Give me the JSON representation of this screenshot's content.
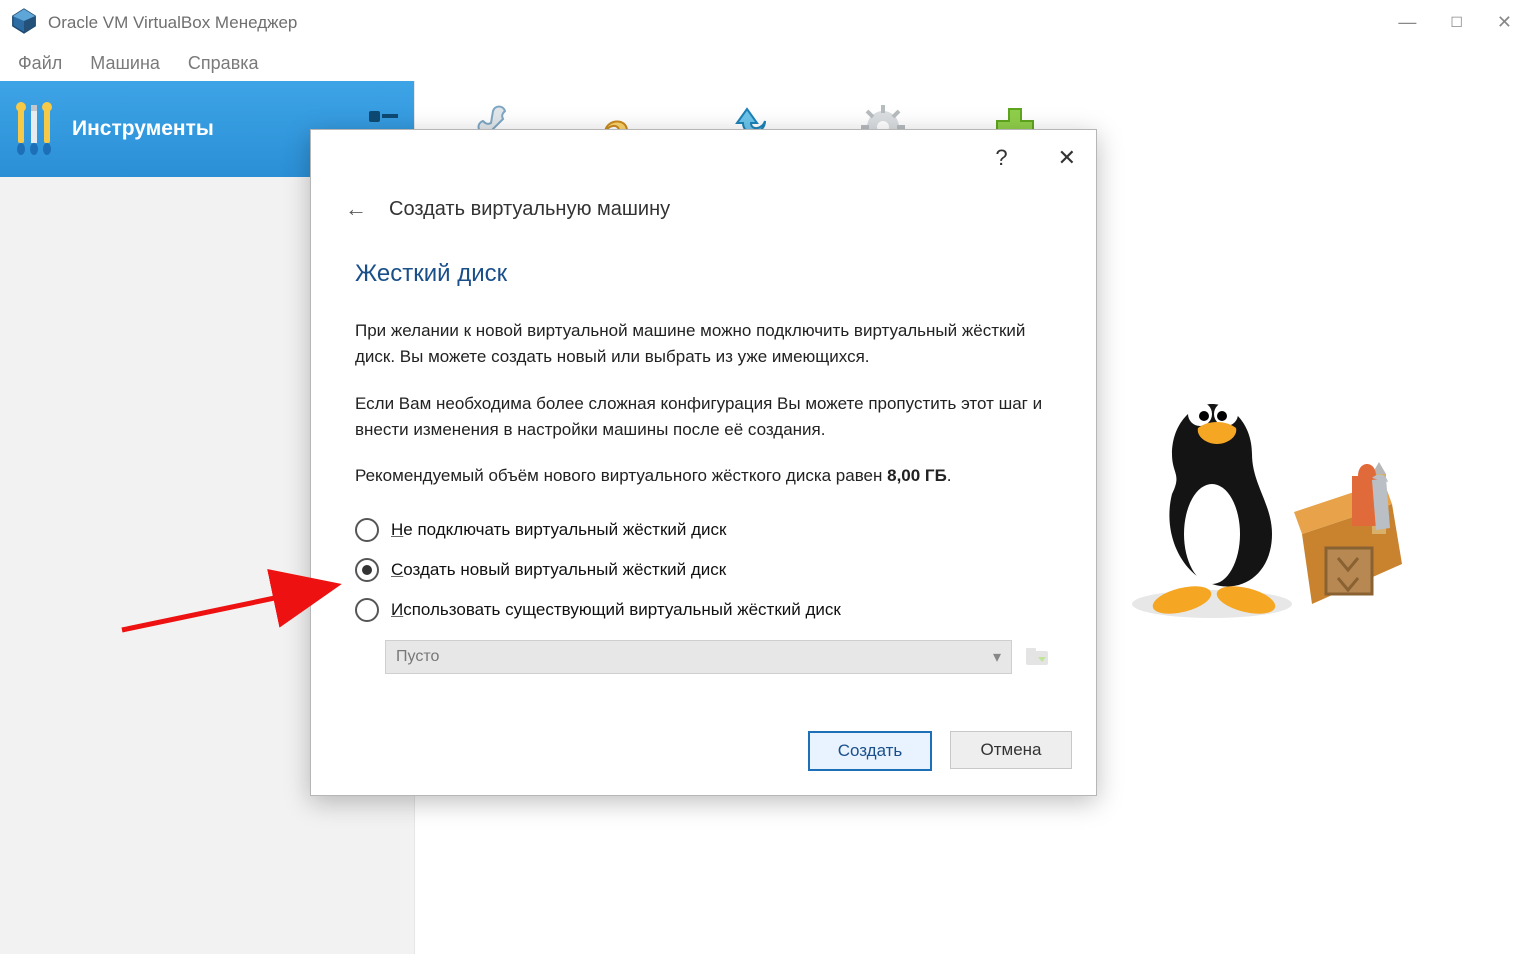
{
  "titlebar": {
    "title": "Oracle VM VirtualBox Менеджер"
  },
  "menubar": {
    "file": "Файл",
    "machine": "Машина",
    "help": "Справка"
  },
  "sidebar": {
    "tools": "Инструменты"
  },
  "dialog": {
    "help": "?",
    "title": "Создать виртуальную машину",
    "section": "Жесткий диск",
    "para1": "При желании к новой виртуальной машине можно подключить виртуальный жёсткий диск. Вы можете создать новый или выбрать из уже имеющихся.",
    "para2": "Если Вам необходима более сложная конфигурация Вы можете пропустить этот шаг и внести изменения в настройки машины после её создания.",
    "para3a": "Рекомендуемый объём нового виртуального жёсткого диска равен ",
    "recommended": "8,00 ГБ",
    "options": [
      {
        "u": "Н",
        "rest": "е подключать виртуальный жёсткий диск"
      },
      {
        "u": "С",
        "rest": "оздать новый виртуальный жёсткий диск"
      },
      {
        "u": "И",
        "rest": "спользовать существующий виртуальный жёсткий диск"
      }
    ],
    "combo": "Пусто",
    "buttons": {
      "create": "Создать",
      "cancel": "Отмена"
    }
  }
}
